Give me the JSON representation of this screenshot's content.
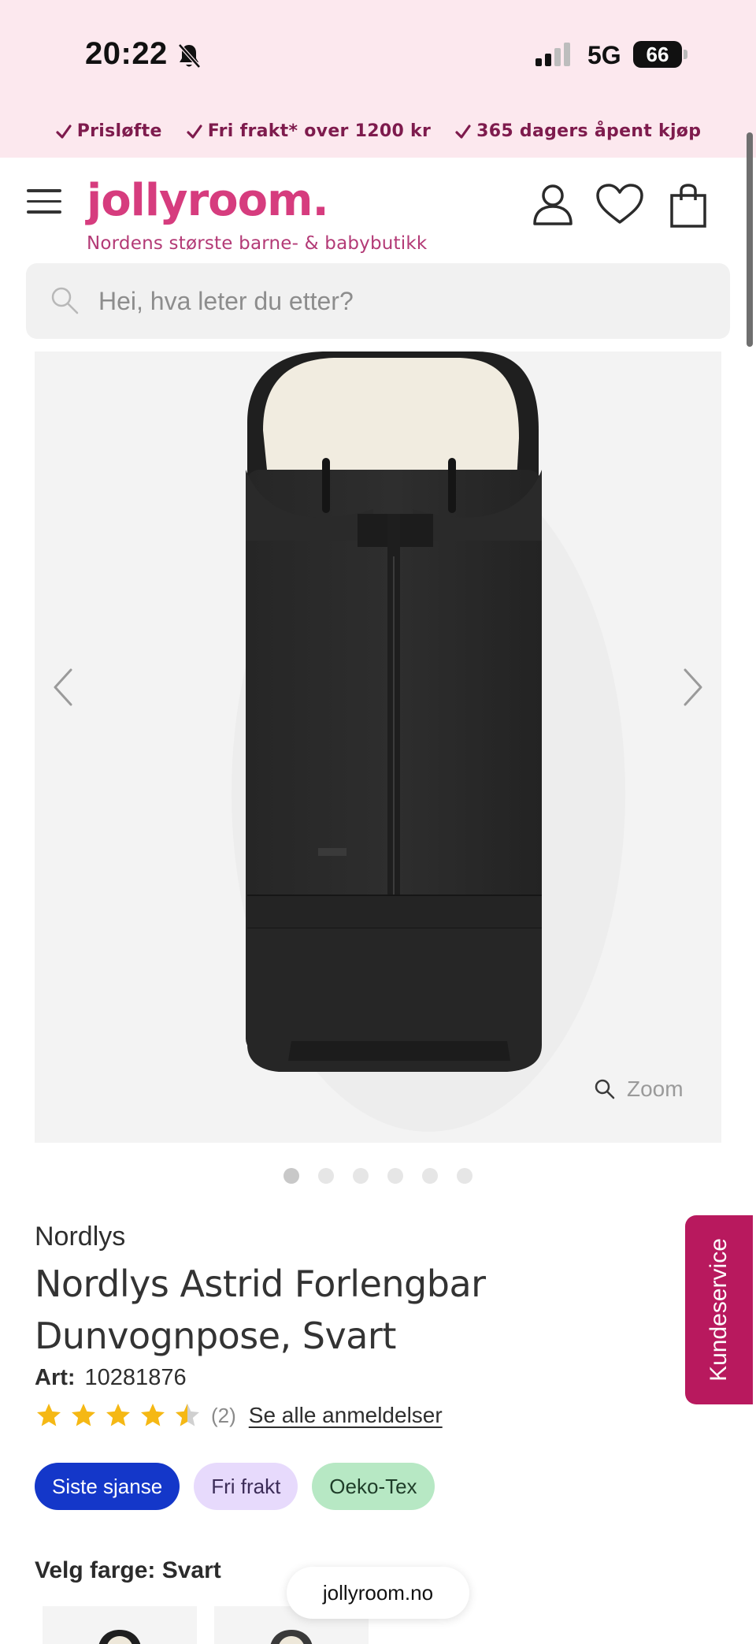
{
  "status_bar": {
    "time": "20:22",
    "network": "5G",
    "battery": "66"
  },
  "promo": [
    {
      "label": "Prisløfte"
    },
    {
      "label": "Fri frakt* over 1200 kr"
    },
    {
      "label": "365 dagers åpent kjøp"
    }
  ],
  "header": {
    "logo": "jollyroom.",
    "tagline": "Nordens største barne- & babybutikk",
    "icons": [
      "menu-icon",
      "user-icon",
      "heart-icon",
      "bag-icon"
    ]
  },
  "search": {
    "placeholder": "Hei, hva leter du etter?"
  },
  "gallery": {
    "zoom_label": "Zoom",
    "slide_count": 6,
    "active_slide": 1
  },
  "product": {
    "brand": "Nordlys",
    "title": "Nordlys Astrid Forlengbar Dunvognpose, Svart",
    "art_label": "Art:",
    "art_number": "10281876",
    "rating": 4.5,
    "rating_count": "(2)",
    "reviews_link": "Se alle anmeldelser",
    "badges": [
      "Siste sjanse",
      "Fri frakt",
      "Oeko-Tex"
    ],
    "color_label": "Velg farge: Svart"
  },
  "side_tab": "Kundeservice",
  "browser": {
    "url": "jollyroom.no"
  },
  "colors": {
    "brand_pink": "#d63c7e",
    "promo_text": "#7e1b4d",
    "side_tab": "#b8195e",
    "badge_blue": "#1437c9",
    "badge_purple": "#e7dafc",
    "badge_green": "#b7e8c4",
    "star": "#f5b814"
  }
}
